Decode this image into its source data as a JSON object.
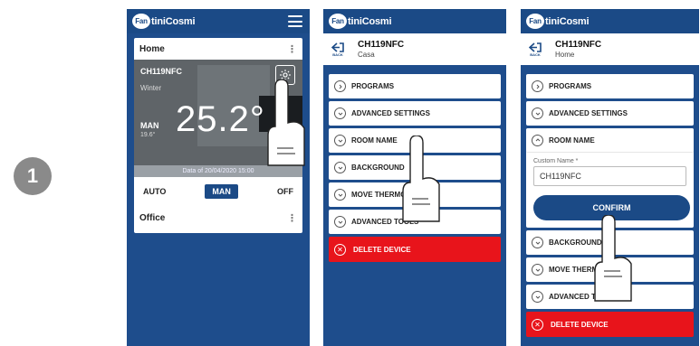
{
  "step": {
    "number": "1"
  },
  "brand": {
    "logo_badge": "Fan",
    "logo_text": "tiniCosmi"
  },
  "screen1": {
    "home_label": "Home",
    "device_name": "CH119NFC",
    "season": "Winter",
    "mode_short": "MAN",
    "setpoint": "19.6°",
    "temperature": "25.2°",
    "date_text": "Data of 20/04/2020 15:00",
    "modes": [
      "AUTO",
      "MAN",
      "OFF"
    ],
    "office_label": "Office"
  },
  "screen2": {
    "device_name": "CH119NFC",
    "location": "Casa",
    "back_label": "BACK",
    "items": [
      "PROGRAMS",
      "ADVANCED SETTINGS",
      "ROOM NAME",
      "BACKGROUND",
      "MOVE THERMOSTAT",
      "ADVANCED TOOLS"
    ],
    "delete_label": "DELETE DEVICE"
  },
  "screen3": {
    "device_name": "CH119NFC",
    "location": "Home",
    "back_label": "BACK",
    "items_top": [
      "PROGRAMS",
      "ADVANCED SETTINGS"
    ],
    "room_name_label": "ROOM NAME",
    "field_label": "Custom Name *",
    "field_value": "CH119NFC",
    "confirm_label": "CONFIRM",
    "items_bottom": [
      "BACKGROUND",
      "MOVE THERMOSTAT",
      "ADVANCED TOOLS"
    ],
    "delete_label": "DELETE DEVICE"
  },
  "colors": {
    "primary": "#1b4a86",
    "background": "#1e4d8c",
    "danger": "#e8141b"
  }
}
